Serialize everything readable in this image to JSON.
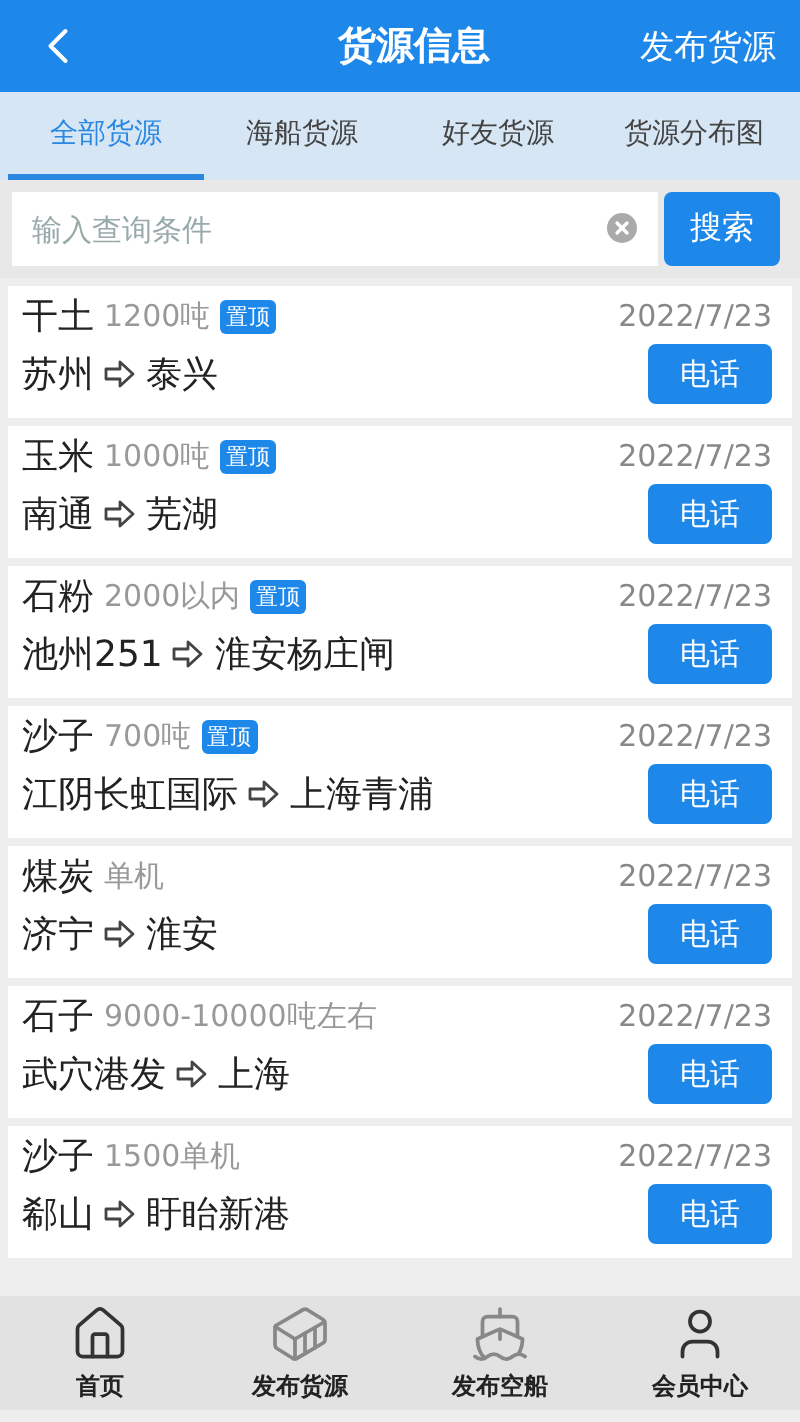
{
  "header": {
    "title": "货源信息",
    "action": "发布货源"
  },
  "tabs": [
    {
      "label": "全部货源",
      "selected": true
    },
    {
      "label": "海船货源",
      "selected": false
    },
    {
      "label": "好友货源",
      "selected": false
    },
    {
      "label": "货源分布图",
      "selected": false
    }
  ],
  "search": {
    "placeholder": "输入查询条件",
    "button": "搜索"
  },
  "listings": [
    {
      "cargo": "干土",
      "amount": "1200吨",
      "pinned": true,
      "badge": "置顶",
      "date": "2022/7/23",
      "from": "苏州",
      "to": "泰兴",
      "call": "电话"
    },
    {
      "cargo": "玉米",
      "amount": "1000吨",
      "pinned": true,
      "badge": "置顶",
      "date": "2022/7/23",
      "from": "南通",
      "to": "芜湖",
      "call": "电话"
    },
    {
      "cargo": "石粉",
      "amount": "2000以内",
      "pinned": true,
      "badge": "置顶",
      "date": "2022/7/23",
      "from": "池州251",
      "to": "淮安杨庄闸",
      "call": "电话"
    },
    {
      "cargo": "沙子",
      "amount": "700吨",
      "pinned": true,
      "badge": "置顶",
      "date": "2022/7/23",
      "from": "江阴长虹国际",
      "to": "上海青浦",
      "call": "电话"
    },
    {
      "cargo": "煤炭",
      "amount": "单机",
      "pinned": false,
      "date": "2022/7/23",
      "from": "济宁",
      "to": "淮安",
      "call": "电话"
    },
    {
      "cargo": "石子",
      "amount": "9000-10000吨左右",
      "pinned": false,
      "date": "2022/7/23",
      "from": "武穴港发",
      "to": "上海",
      "call": "电话"
    },
    {
      "cargo": "沙子",
      "amount": "1500单机",
      "pinned": false,
      "date": "2022/7/23",
      "from": "郗山",
      "to": "盱眙新港",
      "call": "电话"
    }
  ],
  "nav": [
    {
      "kind": "home",
      "label": "首页"
    },
    {
      "kind": "cargo",
      "label": "发布货源"
    },
    {
      "kind": "ship",
      "label": "发布空船"
    },
    {
      "kind": "user",
      "label": "会员中心"
    }
  ]
}
